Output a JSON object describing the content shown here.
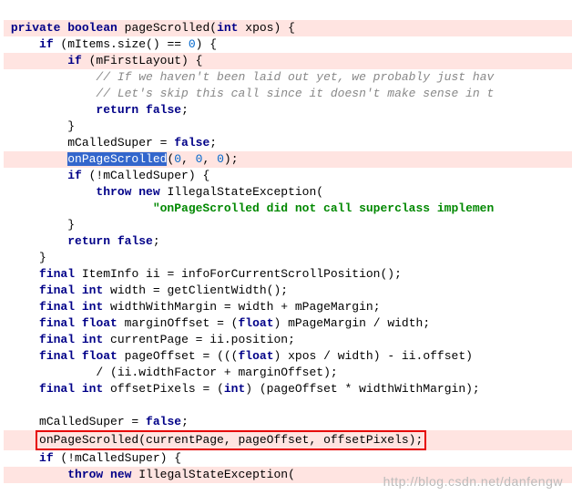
{
  "code": {
    "l01a": "private",
    "l01b": "boolean",
    "l01c": " pageScrolled(",
    "l01d": "int",
    "l01e": " xpos) {",
    "l02a": "if",
    "l02b": " (mItems.size() == ",
    "l02c": "0",
    "l02d": ") {",
    "l03a": "if",
    "l03b": " (mFirstLayout) {",
    "l04": "// If we haven't been laid out yet, we probably just hav",
    "l05": "// Let's skip this call since it doesn't make sense in t",
    "l06a": "return",
    "l06b": "false",
    "l06c": ";",
    "l07": "}",
    "l08a": "mCalledSuper = ",
    "l08b": "false",
    "l08c": ";",
    "l09a": "onPageScrolled",
    "l09b": "(",
    "l09c": "0",
    "l09d": ", ",
    "l09e": "0",
    "l09f": ", ",
    "l09g": "0",
    "l09h": ");",
    "l10a": "if",
    "l10b": " (!mCalledSuper) {",
    "l11a": "throw",
    "l11b": "new",
    "l11c": " IllegalStateException(",
    "l12": "\"onPageScrolled did not call superclass implemen",
    "l13": "}",
    "l14a": "return",
    "l14b": "false",
    "l14c": ";",
    "l15": "}",
    "l16a": "final",
    "l16b": " ItemInfo ii = infoForCurrentScrollPosition();",
    "l17a": "final",
    "l17b": "int",
    "l17c": " width = getClientWidth();",
    "l18a": "final",
    "l18b": "int",
    "l18c": " widthWithMargin = width + mPageMargin;",
    "l19a": "final",
    "l19b": "float",
    "l19c": " marginOffset = (",
    "l19d": "float",
    "l19e": ") mPageMargin / width;",
    "l20a": "final",
    "l20b": "int",
    "l20c": " currentPage = ii.position;",
    "l21a": "final",
    "l21b": "float",
    "l21c": " pageOffset = (((",
    "l21d": "float",
    "l21e": ") xpos / width) - ii.offset)",
    "l22": "/ (ii.widthFactor + marginOffset);",
    "l23a": "final",
    "l23b": "int",
    "l23c": " offsetPixels = (",
    "l23d": "int",
    "l23e": ") (pageOffset * widthWithMargin);",
    "l24a": "mCalledSuper = ",
    "l24b": "false",
    "l24c": ";",
    "l25": "onPageScrolled(currentPage, pageOffset, offsetPixels);",
    "l26a": "if",
    "l26b": " (!mCalledSuper) {",
    "l27a": "throw",
    "l27b": "new",
    "l27c": " IllegalStateException("
  },
  "watermark": "http://blog.csdn.net/danfengw"
}
